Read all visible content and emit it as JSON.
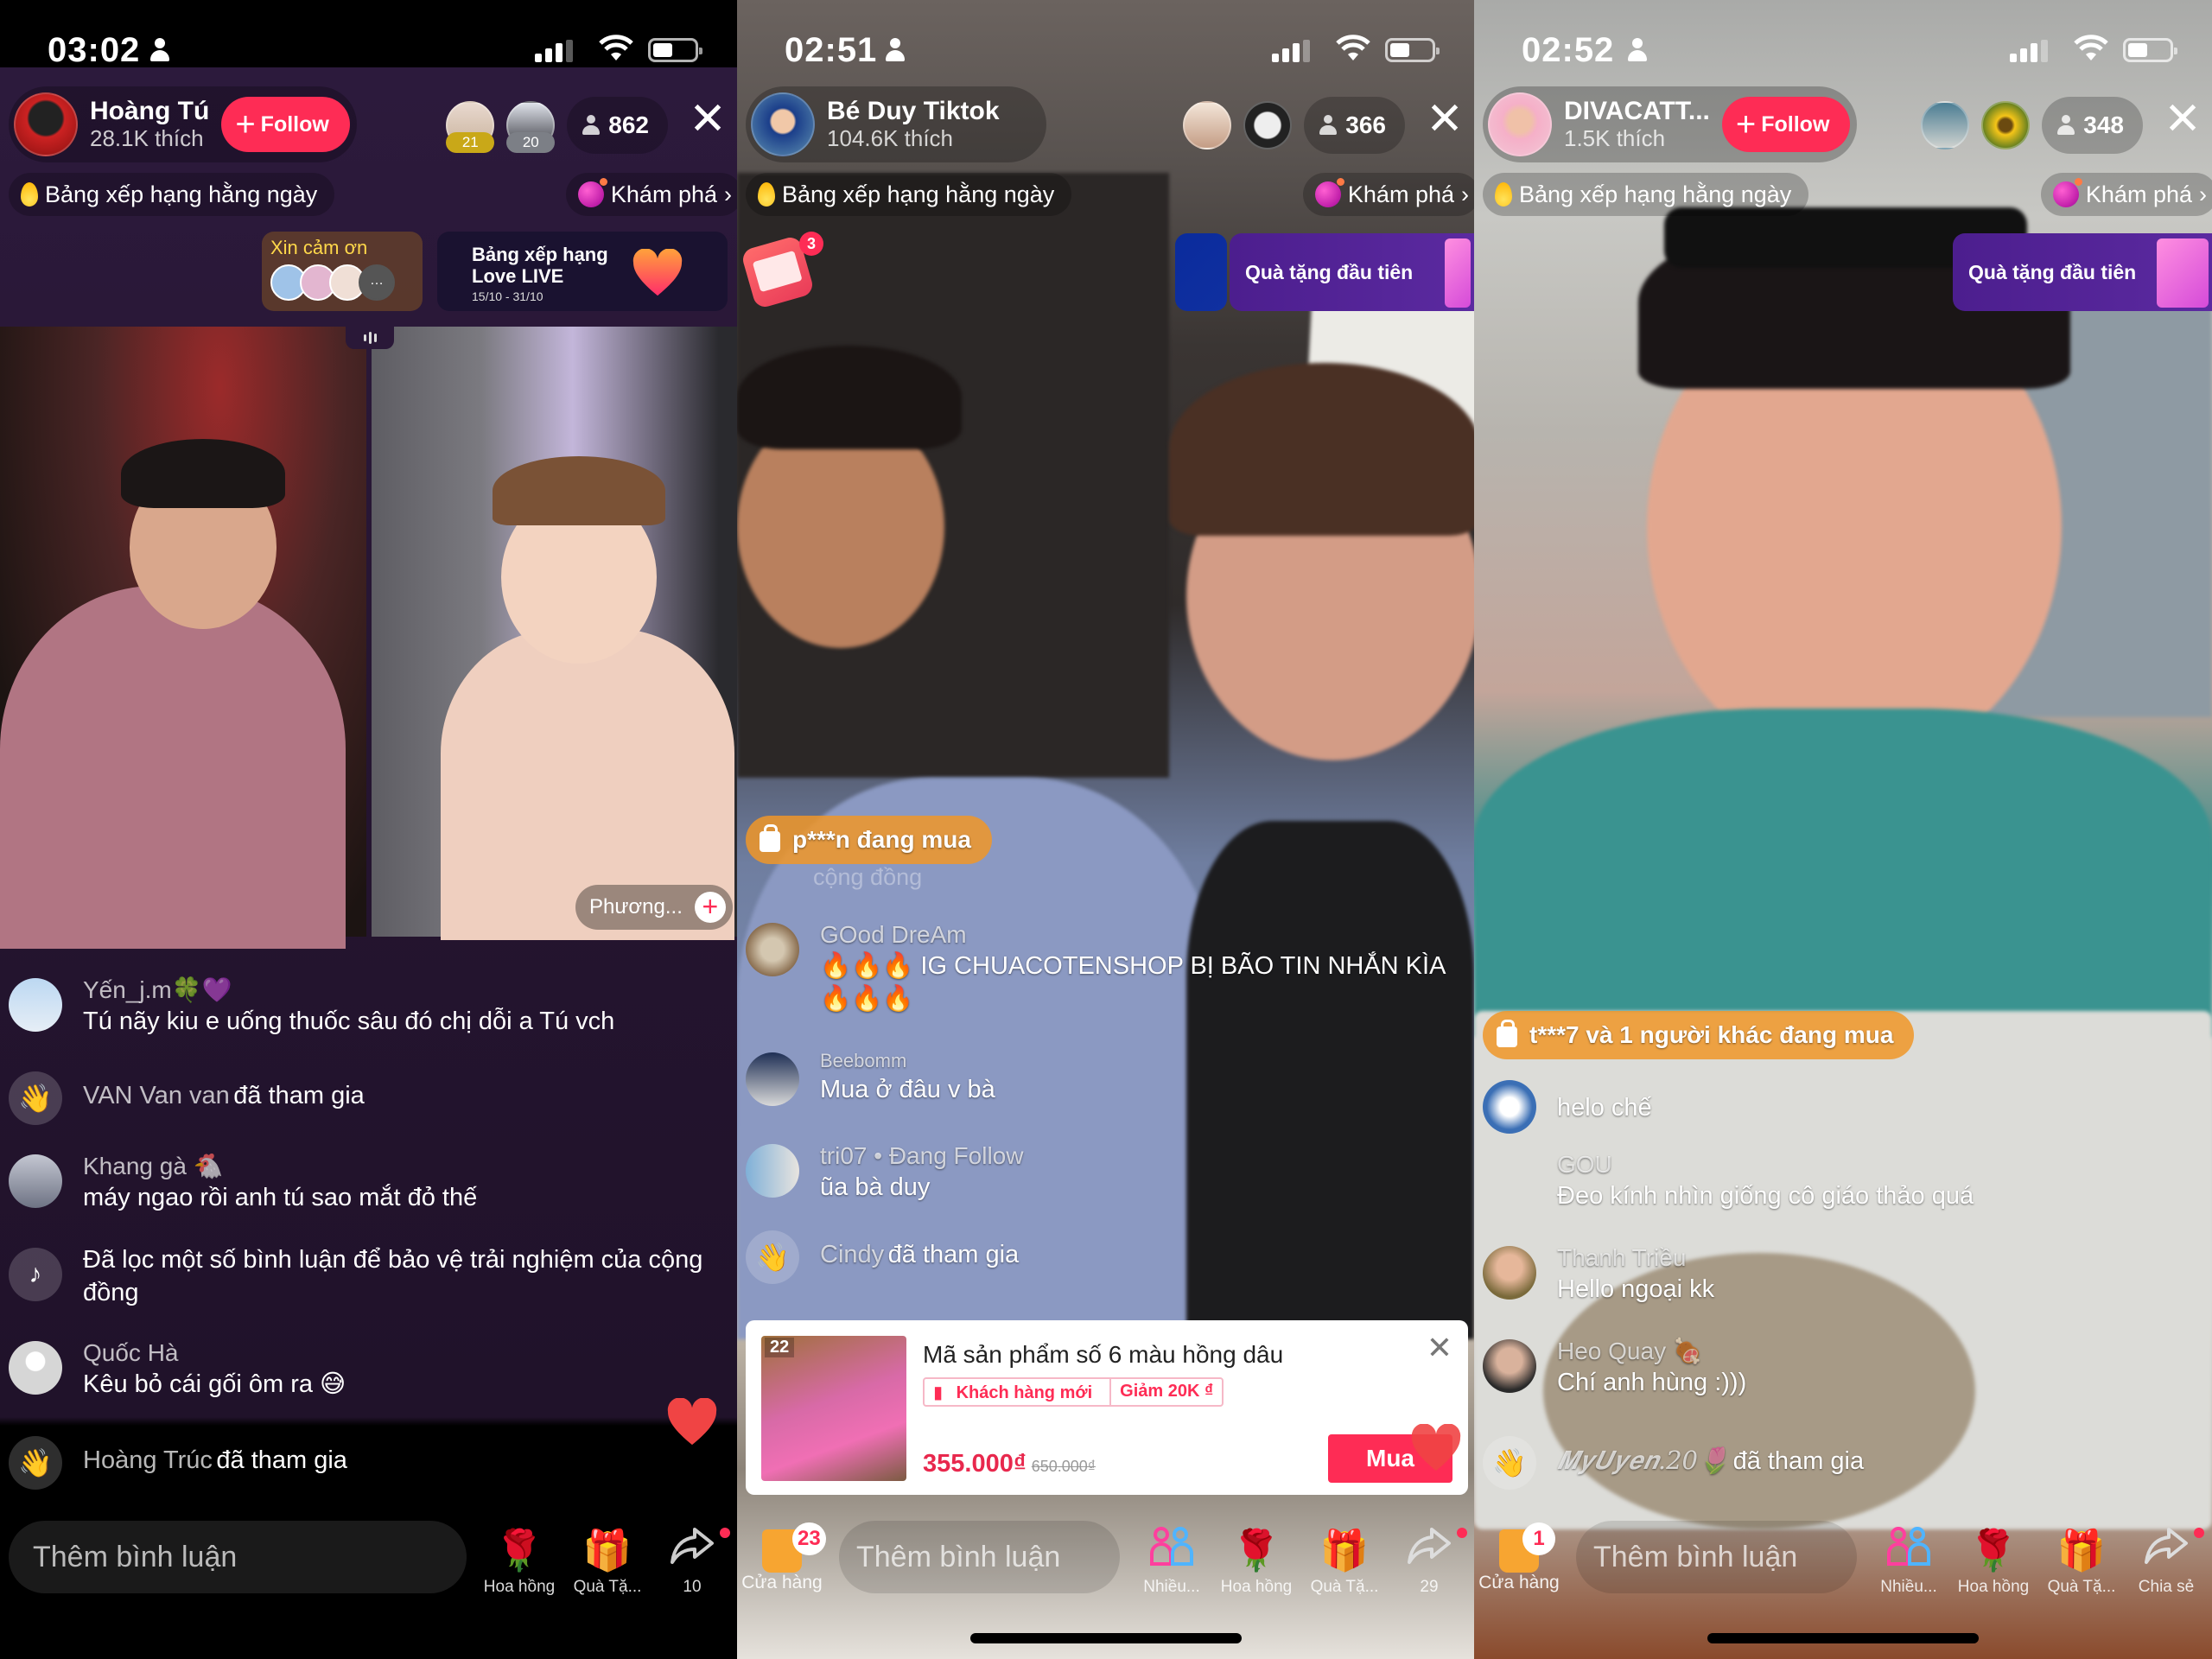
{
  "panels": [
    {
      "status": {
        "time": "03:02"
      },
      "host": {
        "name": "Hoàng Tú",
        "likes": "28.1K thích",
        "follow_label": "Follow"
      },
      "top_viewers": [
        {
          "rank": "21",
          "rank_color": "#c9a818"
        },
        {
          "rank": "20",
          "rank_color": "#7c7f86"
        }
      ],
      "viewer_count": "862",
      "chips": {
        "ranking": "Bảng xếp hạng hằng ngày",
        "explore": "Khám phá"
      },
      "thanks_label": "Xin cảm ơn",
      "love_banner": {
        "title_line1": "Bảng xếp hạng",
        "title_line2": "Love LIVE",
        "dates": "15/10 - 31/10"
      },
      "guest_name": "Phương...",
      "comments": [
        {
          "user": "Yến_j.m🍀💜",
          "text": "Tú nãy kiu e uống thuốc sâu đó chị dỗi a Tú vch"
        },
        {
          "user": "VAN Van van",
          "text": "đã tham gia",
          "type": "join"
        },
        {
          "user": "Khang gà 🐔",
          "text": "máy ngao rồi anh tú sao mắt đỏ thế"
        },
        {
          "user": "",
          "text": "Đã lọc một số bình luận để bảo vệ trải nghiệm của cộng đồng",
          "type": "system"
        },
        {
          "user": "Quốc Hà",
          "text": "Kêu bỏ cái gối ôm ra 😅"
        },
        {
          "user": "Hoàng Trúc",
          "text": "đã tham gia",
          "type": "join"
        }
      ],
      "input_placeholder": "Thêm bình luận",
      "actions": [
        {
          "icon": "rose-icon",
          "glyph": "🌹",
          "label": "Hoa hồng"
        },
        {
          "icon": "gift-icon",
          "glyph": "🎁",
          "label": "Quà Tặ..."
        },
        {
          "icon": "share-icon",
          "glyph": "↪",
          "label": "10"
        }
      ]
    },
    {
      "status": {
        "time": "02:51"
      },
      "host": {
        "name": "Bé Duy Tiktok",
        "likes": "104.6K thích"
      },
      "viewer_count": "366",
      "chips": {
        "ranking": "Bảng xếp hạng hằng ngày",
        "explore": "Khám phá"
      },
      "envelope_badge": "3",
      "first_gift_banner": "Quà tặng đầu tiên",
      "purchase_banner": "p***n đang mua",
      "faded_text": "cộng đồng",
      "comments": [
        {
          "user": "GOod DreAm",
          "text": "🔥🔥🔥 IG CHUACOTENSHOP BỊ BÃO TIN NHẮN KÌA 🔥🔥🔥"
        },
        {
          "user": "Beebomm",
          "text": "Mua ở đâu v bà"
        },
        {
          "user": "tri07 • Đang Follow",
          "text": "ũa bà duy"
        },
        {
          "user": "Cindy",
          "text": "đã tham gia",
          "type": "join"
        }
      ],
      "product": {
        "number": "22",
        "title": "Mã sản phẩm số 6 màu hồng dâu",
        "tag_new": "Khách hàng mới",
        "tag_discount": "Giảm 20K ₫",
        "price": "355.000₫",
        "old_price": "650.000₫",
        "buy_label": "Mua"
      },
      "shop": {
        "label": "Cửa hàng",
        "count": "23"
      },
      "input_placeholder": "Thêm bình luận",
      "actions": [
        {
          "icon": "multi-guest-icon",
          "glyph": "👥",
          "label": "Nhiều..."
        },
        {
          "icon": "rose-icon",
          "glyph": "🌹",
          "label": "Hoa hồng"
        },
        {
          "icon": "gift-icon",
          "glyph": "🎁",
          "label": "Quà Tặ..."
        },
        {
          "icon": "share-icon",
          "glyph": "↪",
          "label": "29"
        }
      ]
    },
    {
      "status": {
        "time": "02:52"
      },
      "host": {
        "name": "DIVACATT...",
        "likes": "1.5K thích",
        "follow_label": "Follow"
      },
      "viewer_count": "348",
      "chips": {
        "ranking": "Bảng xếp hạng hằng ngày",
        "explore": "Khám phá"
      },
      "first_gift_banner": "Quà tặng đầu tiên",
      "purchase_banner": "t***7 và 1 người khác đang mua",
      "comments": [
        {
          "user": "",
          "text": "helo chế"
        },
        {
          "user": "GOU",
          "text": "Đeo kính nhìn giống cô giáo thảo quá"
        },
        {
          "user": "Thanh Triều",
          "text": "Hello ngoại kk"
        },
        {
          "user": "Heo Quay 🍖",
          "text": "Chí anh hùng :)))"
        },
        {
          "user": "𝑴𝒚𝑼𝒚𝒆𝒏.20🌷",
          "text": "đã tham gia",
          "type": "join"
        }
      ],
      "shop": {
        "label": "Cửa hàng",
        "count": "1"
      },
      "input_placeholder": "Thêm bình luận",
      "actions": [
        {
          "icon": "multi-guest-icon",
          "glyph": "👥",
          "label": "Nhiều..."
        },
        {
          "icon": "rose-icon",
          "glyph": "🌹",
          "label": "Hoa hồng"
        },
        {
          "icon": "gift-icon",
          "glyph": "🎁",
          "label": "Quà Tặ..."
        },
        {
          "icon": "share-icon",
          "glyph": "↪",
          "label": "Chia sẻ"
        }
      ]
    }
  ],
  "colors": {
    "accent": "#fe2c55",
    "purchase": "#f0962a",
    "gift_banner": "#4c1e8e",
    "left_bg": "#2a1838"
  }
}
